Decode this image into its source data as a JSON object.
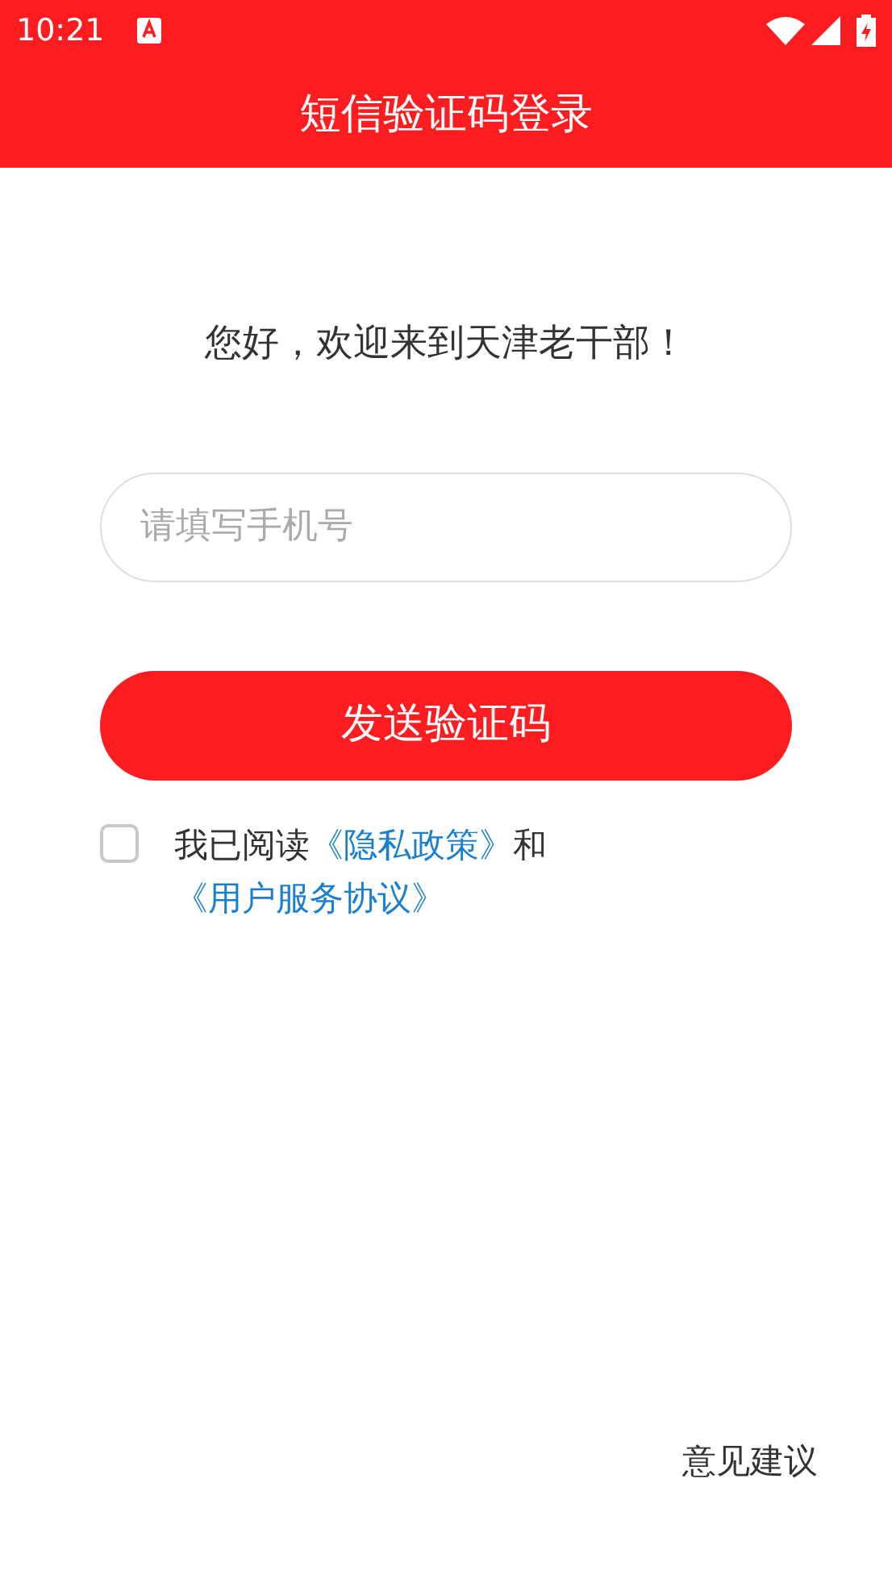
{
  "status_bar": {
    "time": "10:21"
  },
  "header": {
    "title": "短信验证码登录"
  },
  "greeting": "您好，欢迎来到天津老干部！",
  "phone_field": {
    "placeholder": "请填写手机号"
  },
  "send_button": {
    "label": "发送验证码"
  },
  "agreement": {
    "checked": false,
    "parts": [
      {
        "kind": "text",
        "text": "我已阅读"
      },
      {
        "kind": "link",
        "text": "《隐私政策》"
      },
      {
        "kind": "text",
        "text": "和"
      },
      {
        "kind": "link",
        "text": "《用户服务协议》"
      }
    ]
  },
  "feedback_link": "意见建议"
}
